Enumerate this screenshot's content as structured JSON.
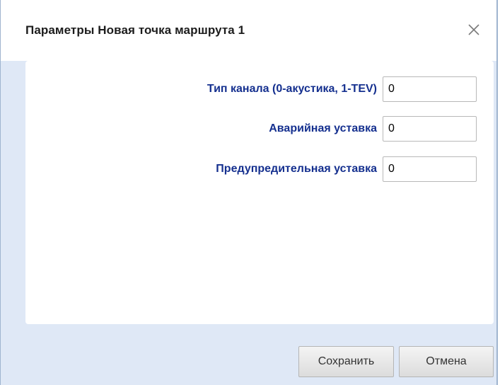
{
  "dialog": {
    "title": "Параметры Новая точка маршрута 1",
    "close_icon": "close-icon",
    "fields": [
      {
        "label": "Тип канала (0-акустика, 1-TEV)",
        "value": "0"
      },
      {
        "label": "Аварийная уставка",
        "value": "0"
      },
      {
        "label": "Предупредительная уставка",
        "value": "0"
      }
    ],
    "buttons": {
      "save_label": "Сохранить",
      "cancel_label": "Отмена"
    }
  },
  "colors": {
    "label": "#15308f",
    "dialog_background": "#dfe8f6",
    "border": "#9fb4cf"
  }
}
